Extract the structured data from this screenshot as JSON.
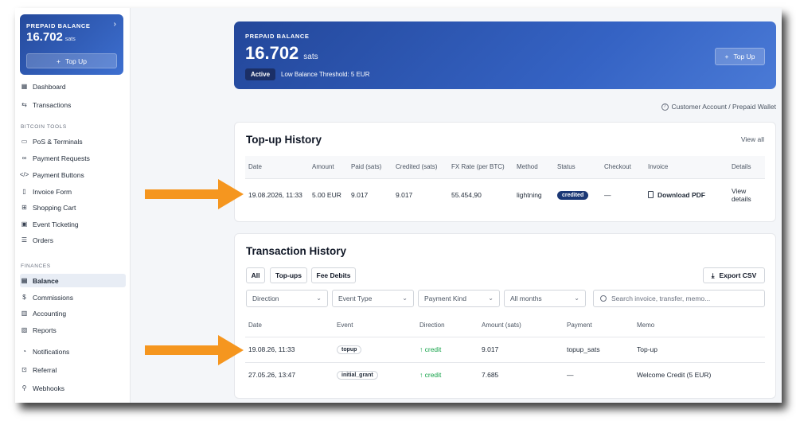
{
  "sidebar": {
    "balance_card": {
      "label": "PREPAID BALANCE",
      "amount": "16.702",
      "unit": "sats",
      "topup_label": "Top Up"
    },
    "items_top": [
      {
        "label": "Dashboard",
        "icon": "grid-icon"
      },
      {
        "label": "Transactions",
        "icon": "swap-icon"
      }
    ],
    "section_bitcoin": "BITCOIN TOOLS",
    "items_bitcoin": [
      {
        "label": "PoS & Terminals",
        "icon": "monitor-icon"
      },
      {
        "label": "Payment Requests",
        "icon": "link-icon"
      },
      {
        "label": "Payment Buttons",
        "icon": "code-icon"
      },
      {
        "label": "Invoice Form",
        "icon": "file-icon"
      },
      {
        "label": "Shopping Cart",
        "icon": "cart-icon"
      },
      {
        "label": "Event Ticketing",
        "icon": "calendar-icon"
      },
      {
        "label": "Orders",
        "icon": "list-icon"
      }
    ],
    "section_finances": "FINANCES",
    "items_finances": [
      {
        "label": "Balance",
        "icon": "wallet-icon"
      },
      {
        "label": "Commissions",
        "icon": "dollar-icon"
      },
      {
        "label": "Accounting",
        "icon": "book-icon"
      },
      {
        "label": "Reports",
        "icon": "report-icon"
      }
    ],
    "items_bottom": [
      {
        "label": "Notifications",
        "icon": "bell-icon"
      },
      {
        "label": "Referral",
        "icon": "gift-icon"
      },
      {
        "label": "Webhooks",
        "icon": "webhook-icon"
      }
    ]
  },
  "hero": {
    "label": "PREPAID BALANCE",
    "amount": "16.702",
    "unit": "sats",
    "status": "Active",
    "threshold": "Low Balance Threshold: 5 EUR",
    "topup_label": "Top Up"
  },
  "breadcrumb": "Customer Account / Prepaid Wallet",
  "topup_history": {
    "title": "Top-up History",
    "view_all": "View all",
    "columns": [
      "Date",
      "Amount",
      "Paid (sats)",
      "Credited (sats)",
      "FX Rate (per BTC)",
      "Method",
      "Status",
      "Checkout",
      "Invoice",
      "Details"
    ],
    "row": {
      "date": "19.08.2026, 11:33",
      "amount": "5.00 EUR",
      "paid": "9.017",
      "credited": "9.017",
      "fx_rate": "55.454,90",
      "method": "lightning",
      "status": "credited",
      "checkout": "—",
      "invoice": "Download PDF",
      "details": "View details"
    }
  },
  "transaction_history": {
    "title": "Transaction History",
    "filters": {
      "all": "All",
      "topups": "Top-ups",
      "fee_debits": "Fee Debits"
    },
    "export": "Export CSV",
    "selects": {
      "direction": "Direction",
      "event_type": "Event Type",
      "payment_kind": "Payment Kind",
      "months": "All months"
    },
    "search_placeholder": "Search invoice, transfer, memo...",
    "columns": [
      "Date",
      "Event",
      "Direction",
      "Amount (sats)",
      "Payment",
      "Memo"
    ],
    "rows": [
      {
        "date": "19.08.26, 11:33",
        "event": "topup",
        "direction": "↑ credit",
        "amount": "9.017",
        "payment": "topup_sats",
        "memo": "Top-up"
      },
      {
        "date": "27.05.26, 13:47",
        "event": "initial_grant",
        "direction": "↑ credit",
        "amount": "7.685",
        "payment": "—",
        "memo": "Welcome Credit (5 EUR)"
      }
    ]
  },
  "colors": {
    "accent": "#2f5bb7",
    "arrow": "#f5961f",
    "credit": "#16a34a",
    "badge": "#1b3875"
  }
}
